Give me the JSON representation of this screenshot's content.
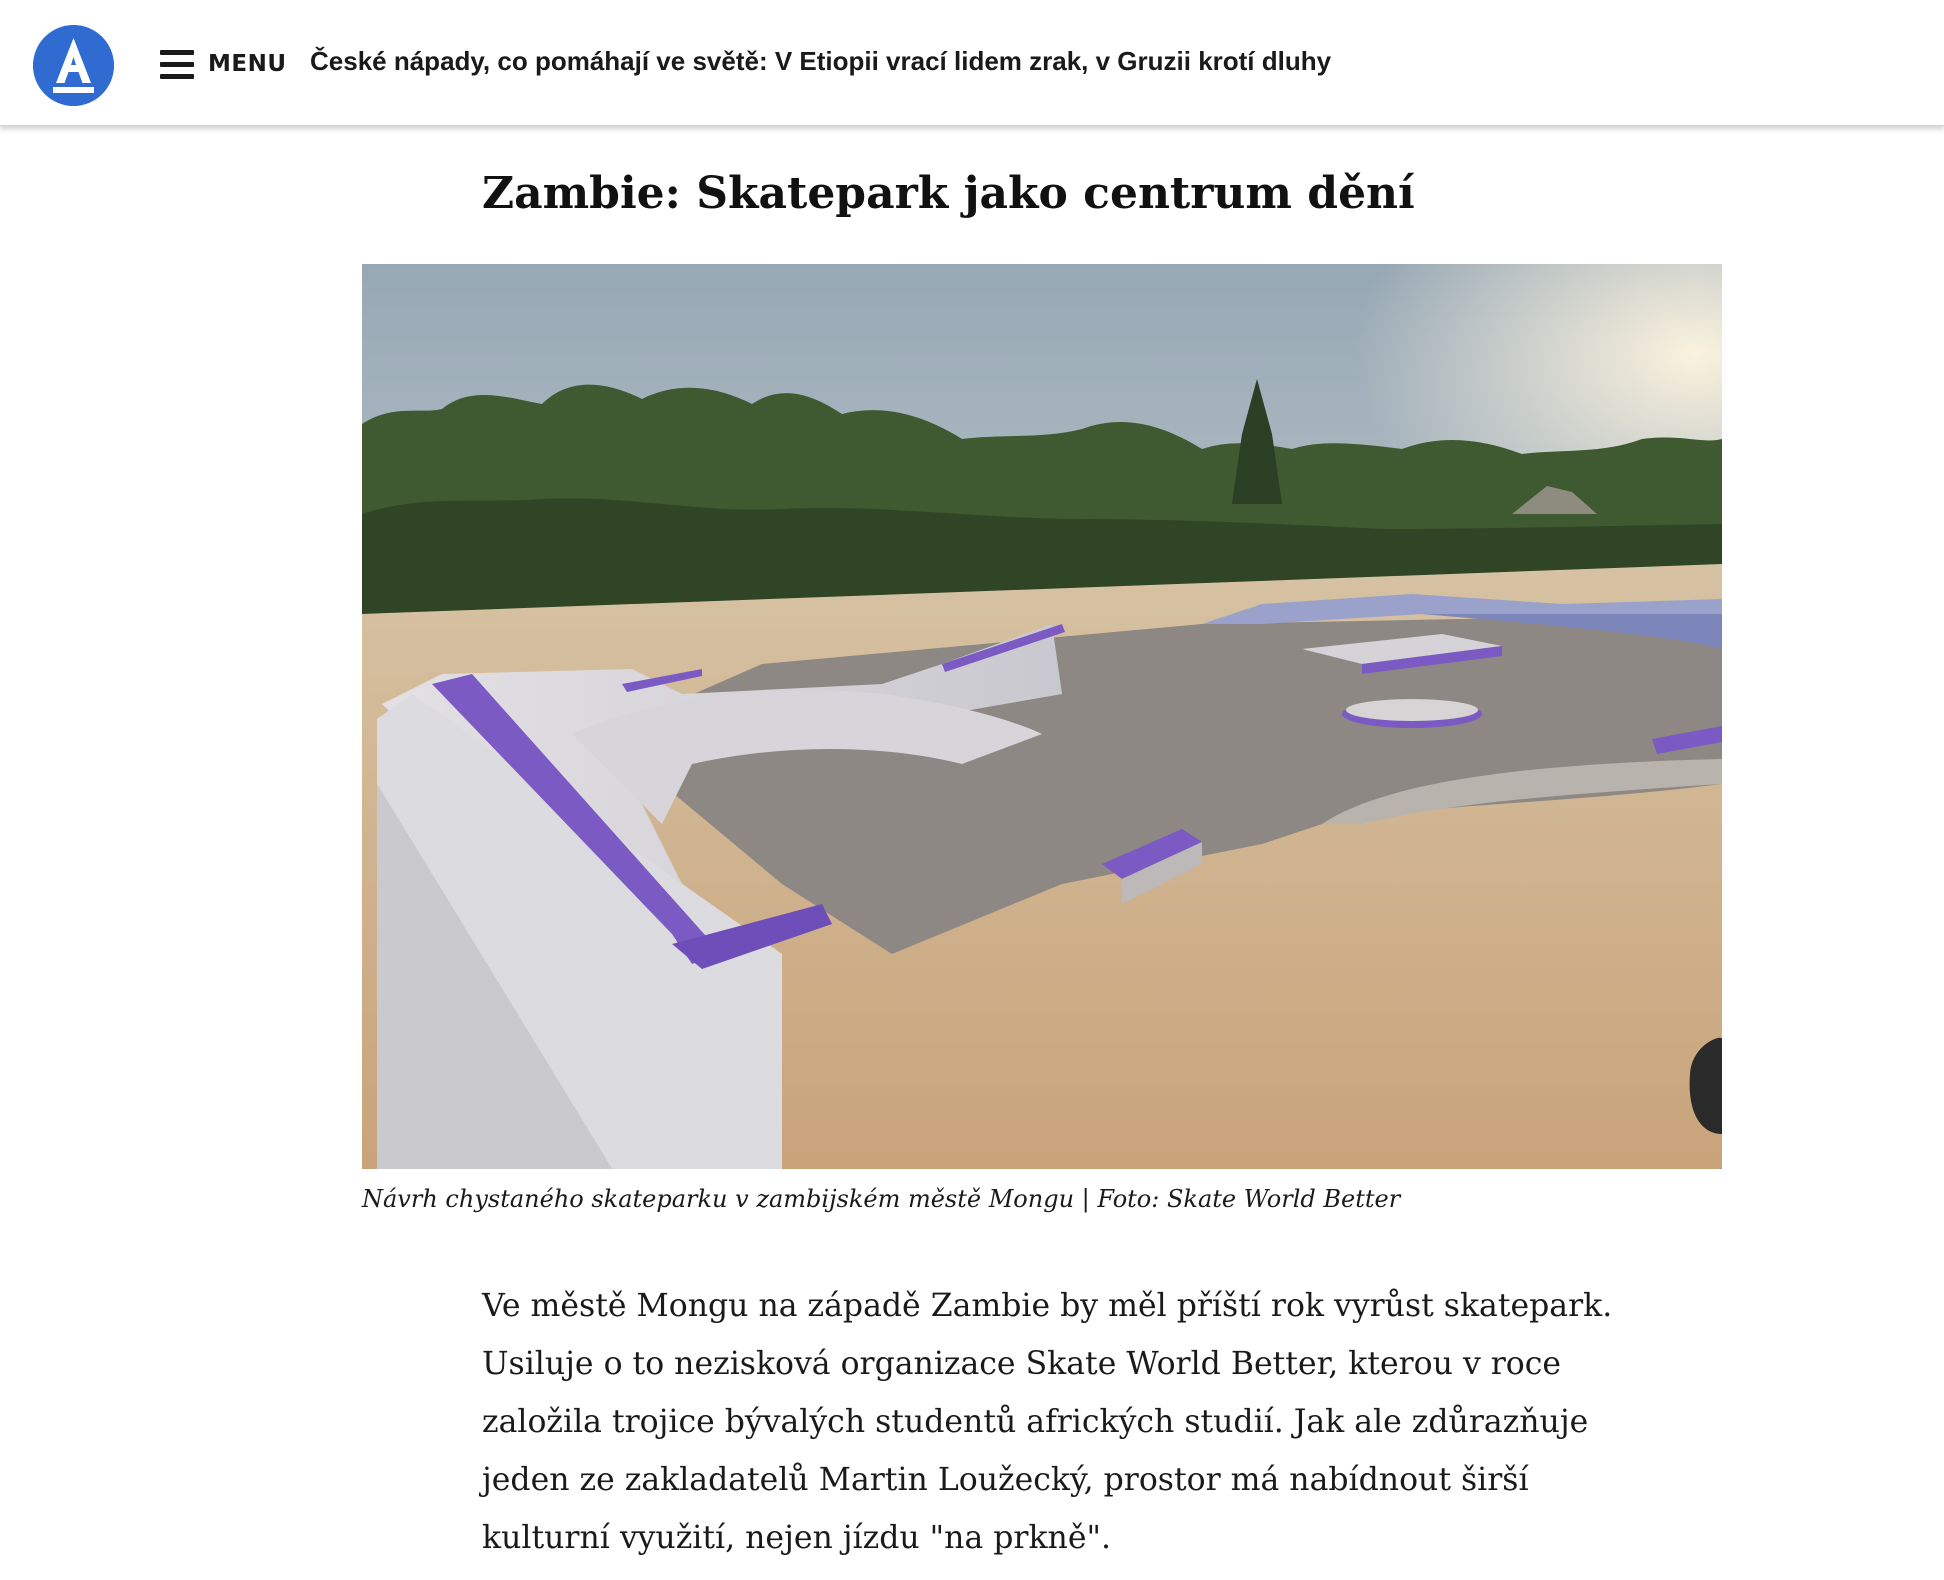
{
  "header": {
    "logo_letter": "A",
    "menu_label": "MENU",
    "headline": "České nápady, co pomáhají ve světě: V Etiopii vrací lidem zrak, v Gruzii krotí dluhy"
  },
  "article": {
    "title": "Zambie: Skatepark jako centrum dění",
    "image_caption": "Návrh chystaného skateparku v zambijském městě Mongu | Foto: Skate World Better",
    "paragraph": "Ve městě Mongu na západě Zambie by měl příští rok vyrůst skatepark. Usiluje o to nezisková organizace Skate World Better, kterou v roce založila trojice bývalých studentů afrických studií. Jak ale zdůrazňuje jeden ze zakladatelů Martin Loužecký, prostor má nabídnout širší kulturní využití, nejen jízdu \"na prkně\"."
  },
  "colors": {
    "brand_blue": "#2f6bd0",
    "text": "#1a1a1a",
    "background": "#ffffff"
  },
  "icons": {
    "menu": "hamburger-icon",
    "logo": "logo-a-icon"
  }
}
